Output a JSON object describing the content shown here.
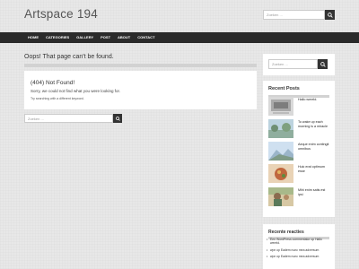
{
  "site": {
    "title": "Artspace 194"
  },
  "header_search": {
    "placeholder": "Zoeken ..."
  },
  "nav": {
    "items": [
      "HOME",
      "CATEGORIES",
      "GALLERY",
      "POST",
      "ABOUT",
      "CONTACT"
    ]
  },
  "main": {
    "page_title": "Oops! That page can't be found.",
    "error_title": "(404) Not Found!",
    "error_desc": "Sorry, we could not find what you were looking for.",
    "error_hint": "Try searching with a different keyword.",
    "search_placeholder": "Zoeken ..."
  },
  "sidebar": {
    "search_placeholder": "Zoeken ...",
    "recent_posts": {
      "title": "Recent Posts",
      "items": [
        "Hallo wereld.",
        "To wake up each morning is a miracle",
        "Aeque enim contingit omnibus",
        "Huic erat optimum esse",
        "Mihi enim satis est ipsi"
      ]
    },
    "recent_comments": {
      "title": "Recente reacties",
      "items": [
        "Een WordPress commentator op Hallo wereld.",
        "wpn op Eadem nunc mea adversum",
        "wpn op Eadem nunc mea adversum"
      ]
    }
  },
  "colors": {
    "nav_bg": "#2b2b2b",
    "page_bg": "#e8e8e8",
    "panel_bg": "#ffffff"
  }
}
